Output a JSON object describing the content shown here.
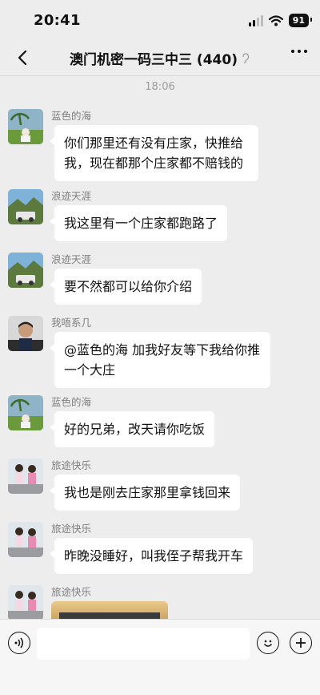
{
  "status_bar": {
    "time": "20:41",
    "battery": "91"
  },
  "header": {
    "title": "澳门机密一码三中三 (440)",
    "back_icon": "chevron-left-icon",
    "more_icon": "more-dots-icon",
    "mute_icon": "ear-icon"
  },
  "timestamp": "18:06",
  "messages": [
    {
      "sender": "蓝色的海",
      "text": "你们那里还有没有庄家，快推给我，现在都那个庄家都不赔钱的"
    },
    {
      "sender": "浪迹天涯",
      "text": "我这里有一个庄家都跑路了"
    },
    {
      "sender": "浪迹天涯",
      "text": "要不然都可以给你介绍"
    },
    {
      "sender": "我唔系几",
      "text": "@蓝色的海 加我好友等下我给你推一个大庄"
    },
    {
      "sender": "蓝色的海",
      "text": "好的兄弟，改天请你吃饭"
    },
    {
      "sender": "旅途快乐",
      "text": "我也是刚去庄家那里拿钱回来"
    },
    {
      "sender": "旅途快乐",
      "text": "昨晚没睡好，叫我侄子帮我开车"
    },
    {
      "sender": "旅途快乐",
      "text": ""
    }
  ],
  "input_bar": {
    "voice_icon": "voice-icon",
    "emoji_icon": "emoji-icon",
    "plus_icon": "plus-icon",
    "value": ""
  },
  "colors": {
    "background": "#ededed",
    "bubble": "#ffffff",
    "timestamp": "#9b9b9b",
    "sender": "#7f7f7f"
  }
}
